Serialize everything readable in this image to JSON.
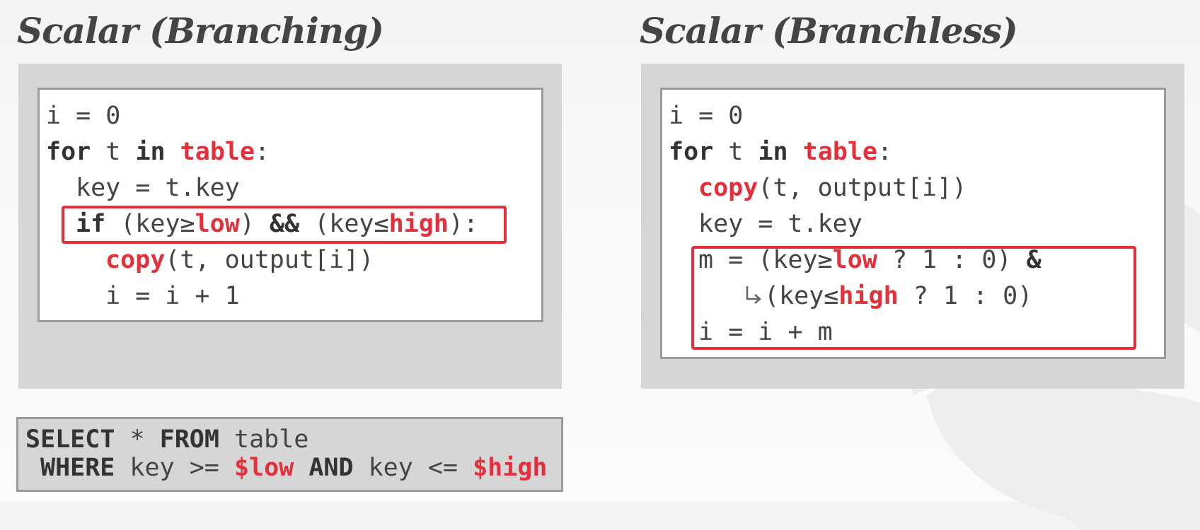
{
  "titles": {
    "left": "Scalar (Branching)",
    "right": "Scalar (Branchless)"
  },
  "branching": {
    "l1": "i = 0",
    "l2": {
      "kw_for": "for",
      "t": " t ",
      "kw_in": "in",
      "sp": " ",
      "table": "table",
      "colon": ":"
    },
    "l3": "key = t.key",
    "l4": {
      "kw_if": "if",
      "p1": " (key≥",
      "low": "low",
      "p2": ") ",
      "and": "&&",
      "p3": " (key≤",
      "high": "high",
      "p4": "):"
    },
    "l5": {
      "copy": "copy",
      "rest": "(t, output[i])"
    },
    "l6": "i = i + 1"
  },
  "branchless": {
    "l1": "i = 0",
    "l2": {
      "kw_for": "for",
      "t": " t ",
      "kw_in": "in",
      "sp": " ",
      "table": "table",
      "colon": ":"
    },
    "l3": {
      "copy": "copy",
      "rest": "(t, output[i])"
    },
    "l4": "key = t.key",
    "l5": {
      "p1": "m = (key≥",
      "low": "low",
      "p2": " ? 1 : 0) ",
      "amp": "&"
    },
    "l6": {
      "p1": "(key≤",
      "high": "high",
      "p2": " ? 1 : 0)"
    },
    "l7": "i = i + m"
  },
  "sql": {
    "select": "SELECT",
    "star": " * ",
    "from": "FROM",
    "table": " table",
    "where": "WHERE",
    "key1": " key >= ",
    "low": "$low",
    "sp1": " ",
    "and": "AND",
    "key2": " key <= ",
    "high": "$high"
  },
  "colors": {
    "accent": "#e5303b",
    "text": "#444444",
    "panel": "#d6d6d6",
    "border": "#9a9a9a"
  },
  "icons": {
    "continuation": "line-continuation-arrow-icon"
  }
}
